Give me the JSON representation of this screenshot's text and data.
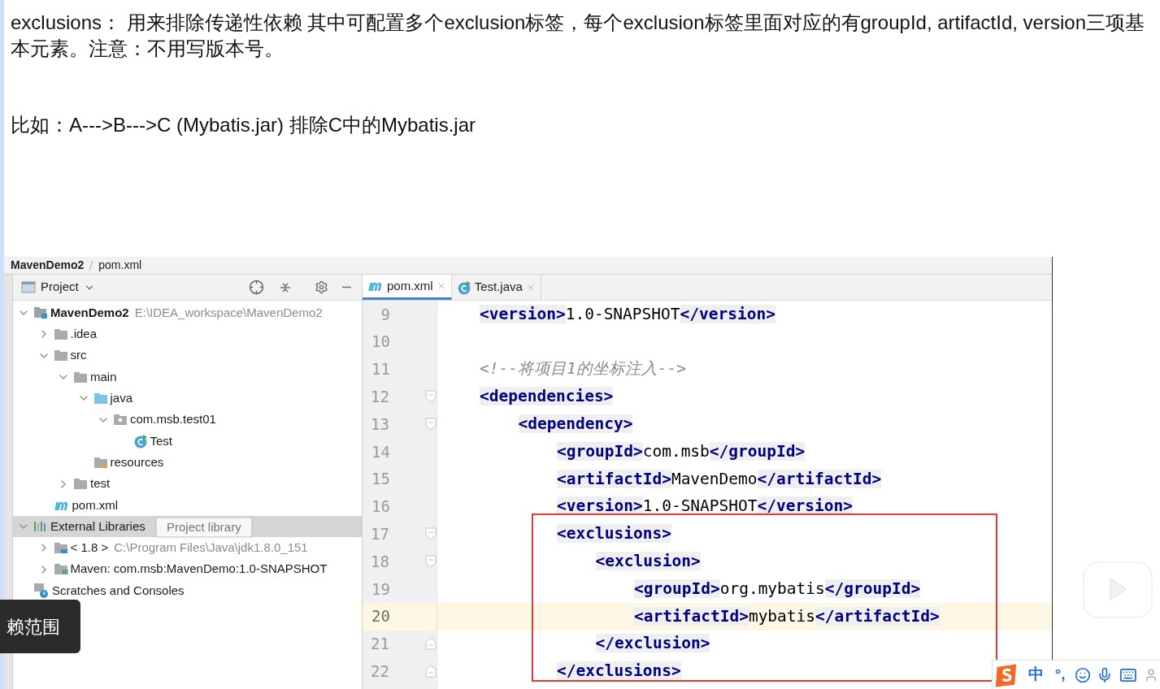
{
  "notes": [
    "exclusions： 用来排除传递性依赖 其中可配置多个exclusion标签，每个exclusion标签里面对应的有groupId, artifactId, version三项基本元素。注意：不用写版本号。",
    "比如：A--->B--->C (Mybatis.jar) 排除C中的Mybatis.jar"
  ],
  "breadcrumb": [
    {
      "label": "MavenDemo2",
      "kind": "module"
    },
    {
      "label": "pom.xml",
      "kind": "maven"
    }
  ],
  "project_panel": {
    "title": "Project",
    "tree": [
      {
        "label": "MavenDemo2",
        "hint": "E:\\IDEA_workspace\\MavenDemo2",
        "kind": "module",
        "expanded": true,
        "selected": false,
        "children": [
          {
            "label": ".idea",
            "kind": "folder",
            "expanded": false,
            "selected": false
          },
          {
            "label": "src",
            "kind": "folder",
            "expanded": true,
            "selected": false,
            "children": [
              {
                "label": "main",
                "kind": "folder",
                "expanded": true,
                "selected": false,
                "children": [
                  {
                    "label": "java",
                    "kind": "source",
                    "expanded": true,
                    "selected": false,
                    "children": [
                      {
                        "label": "com.msb.test01",
                        "kind": "package",
                        "expanded": true,
                        "selected": false,
                        "children": [
                          {
                            "label": "Test",
                            "kind": "class",
                            "selected": false
                          }
                        ]
                      }
                    ]
                  },
                  {
                    "label": "resources",
                    "kind": "resources",
                    "selected": false
                  }
                ]
              },
              {
                "label": "test",
                "kind": "folder",
                "expanded": false,
                "selected": false
              }
            ]
          },
          {
            "label": "pom.xml",
            "kind": "maven",
            "selected": false
          }
        ]
      },
      {
        "label": "External Libraries",
        "kind": "libraries",
        "expanded": true,
        "selected": true,
        "tooltip": "Project library",
        "children": [
          {
            "label": "< 1.8 >",
            "hint": "C:\\Program Files\\Java\\jdk1.8.0_151",
            "kind": "jdk",
            "expanded": false,
            "selected": false
          },
          {
            "label": "Maven: com.msb:MavenDemo:1.0-SNAPSHOT",
            "kind": "library",
            "expanded": false,
            "selected": false
          }
        ]
      },
      {
        "label": "Scratches and Consoles",
        "kind": "scratches",
        "selected": false
      }
    ]
  },
  "editor": {
    "tabs": [
      {
        "label": "pom.xml",
        "kind": "maven",
        "selected": true
      },
      {
        "label": "Test.java",
        "kind": "class",
        "selected": false
      }
    ],
    "lines": [
      {
        "number": "9",
        "fold_marker": false,
        "current": false,
        "boxed": false,
        "segments": [
          {
            "kind": "tag",
            "text": "<version>"
          },
          {
            "kind": "text",
            "text": "1.0-SNAPSHOT"
          },
          {
            "kind": "tag",
            "text": "</version>"
          }
        ]
      },
      {
        "number": "10",
        "fold_marker": false,
        "current": false,
        "boxed": false
      },
      {
        "number": "11",
        "fold_marker": false,
        "current": false,
        "boxed": false,
        "segments": [
          {
            "kind": "comment",
            "text": "<!--将项目1的坐标注入-->"
          }
        ]
      },
      {
        "number": "12",
        "fold_marker": true,
        "current": false,
        "boxed": false,
        "segments": [
          {
            "kind": "tag",
            "text": "<dependencies>"
          }
        ],
        "children": [
          {
            "number": "13",
            "fold_marker": true,
            "current": false,
            "boxed": false,
            "segments": [
              {
                "kind": "tag",
                "text": "<dependency>"
              }
            ],
            "children": [
              {
                "number": "14",
                "fold_marker": false,
                "current": false,
                "boxed": false,
                "segments": [
                  {
                    "kind": "tag",
                    "text": "<groupId>"
                  },
                  {
                    "kind": "text",
                    "text": "com.msb"
                  },
                  {
                    "kind": "tag",
                    "text": "</groupId>"
                  }
                ]
              },
              {
                "number": "15",
                "fold_marker": false,
                "current": false,
                "boxed": false,
                "segments": [
                  {
                    "kind": "tag",
                    "text": "<artifactId>"
                  },
                  {
                    "kind": "text",
                    "text": "MavenDemo"
                  },
                  {
                    "kind": "tag",
                    "text": "</artifactId>"
                  }
                ]
              },
              {
                "number": "16",
                "fold_marker": false,
                "current": false,
                "boxed": false,
                "segments": [
                  {
                    "kind": "tag",
                    "text": "<version>"
                  },
                  {
                    "kind": "text",
                    "text": "1.0-SNAPSHOT"
                  },
                  {
                    "kind": "tag",
                    "text": "</version>"
                  }
                ]
              },
              {
                "number": "17",
                "fold_marker": true,
                "current": false,
                "boxed": true,
                "segments": [
                  {
                    "kind": "tag",
                    "text": "<exclusions>"
                  }
                ],
                "children": [
                  {
                    "number": "18",
                    "fold_marker": true,
                    "current": false,
                    "boxed": true,
                    "segments": [
                      {
                        "kind": "tag",
                        "text": "<exclusion>"
                      }
                    ],
                    "children": [
                      {
                        "number": "19",
                        "fold_marker": false,
                        "current": false,
                        "boxed": true,
                        "segments": [
                          {
                            "kind": "tag",
                            "text": "<groupId>"
                          },
                          {
                            "kind": "text",
                            "text": "org.mybatis"
                          },
                          {
                            "kind": "tag",
                            "text": "</groupId>"
                          }
                        ]
                      },
                      {
                        "number": "20",
                        "fold_marker": false,
                        "current": true,
                        "boxed": true,
                        "segments": [
                          {
                            "kind": "tag",
                            "text": "<artifactId>"
                          },
                          {
                            "kind": "text",
                            "text": "mybatis"
                          },
                          {
                            "kind": "tag",
                            "text": "</artifactId>"
                          }
                        ]
                      }
                    ]
                  },
                  {
                    "number": "21",
                    "fold_marker": true,
                    "current": false,
                    "boxed": true,
                    "segments": [
                      {
                        "kind": "tag",
                        "text": "</exclusion>"
                      }
                    ]
                  }
                ]
              },
              {
                "number": "22",
                "fold_marker": true,
                "current": false,
                "boxed": true,
                "segments": [
                  {
                    "kind": "tag",
                    "text": "</exclusions>"
                  }
                ]
              }
            ]
          }
        ]
      }
    ]
  },
  "caption": "赖范围",
  "ime_toolbar": [
    {
      "kind": "logo"
    },
    {
      "kind": "text",
      "text": "中"
    },
    {
      "kind": "text",
      "text": "°,"
    },
    {
      "kind": "emoji"
    },
    {
      "kind": "mic"
    },
    {
      "kind": "keyboard"
    },
    {
      "kind": "user"
    }
  ]
}
